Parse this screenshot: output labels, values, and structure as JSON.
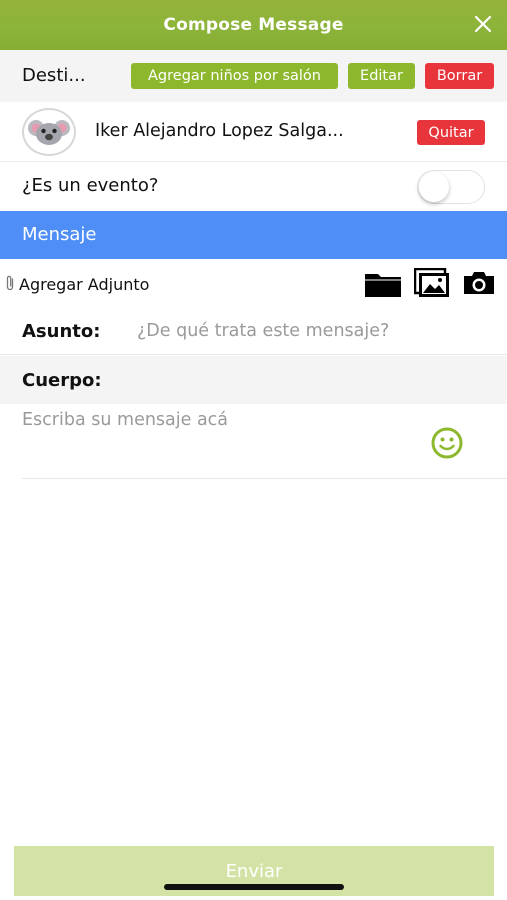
{
  "header": {
    "title": "Compose Message",
    "close_icon": "close-icon",
    "color": "#8db43a"
  },
  "recipients": {
    "label": "Desti...",
    "add_by_room_label": "Agregar niños por salón",
    "edit_label": "Editar",
    "delete_label": "Borrar",
    "items": [
      {
        "name": "Iker Alejandro Lopez Salga...",
        "avatar_icon": "koala-avatar-icon",
        "remove_label": "Quitar"
      }
    ]
  },
  "event": {
    "label": "¿Es un evento?",
    "enabled": false
  },
  "message_section": {
    "title": "Mensaje",
    "color": "#4f8ef7"
  },
  "attachments": {
    "label": "Agregar Adjunto",
    "icons": [
      "paperclip-icon",
      "folder-icon",
      "gallery-icon",
      "camera-icon"
    ]
  },
  "subject": {
    "label": "Asunto:",
    "placeholder": "¿De qué trata este mensaje?",
    "value": ""
  },
  "body": {
    "label": "Cuerpo:",
    "placeholder": "Escriba su mensaje acá",
    "value": "",
    "emoji_icon": "emoji-icon"
  },
  "send": {
    "label": "Enviar"
  }
}
